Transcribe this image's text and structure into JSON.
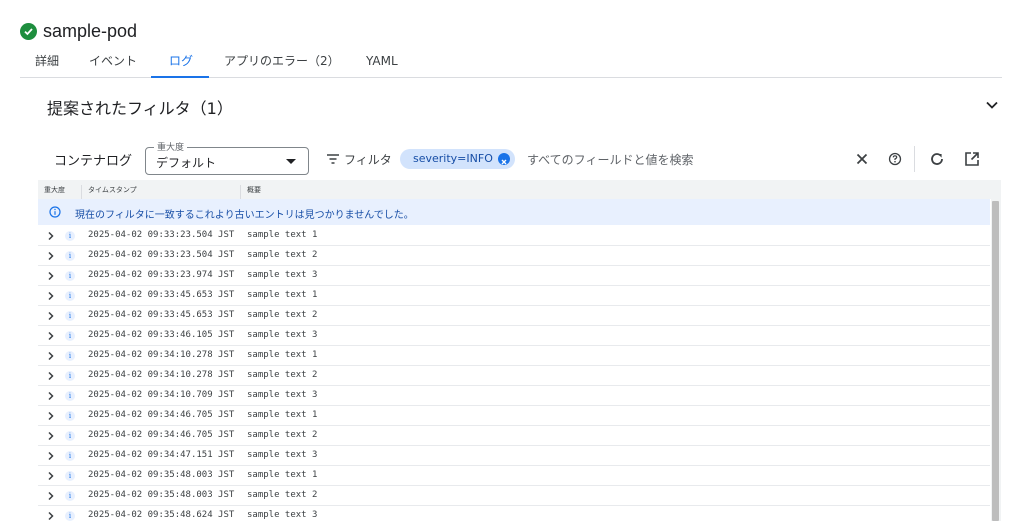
{
  "header": {
    "title": "sample-pod",
    "status_icon": "check-circle-icon",
    "status_color": "#1e8e3e"
  },
  "tabs": [
    {
      "label": "詳細"
    },
    {
      "label": "イベント"
    },
    {
      "label": "ログ",
      "active": true
    },
    {
      "label": "アプリのエラー（2）"
    },
    {
      "label": "YAML"
    }
  ],
  "suggested_filters": {
    "label": "提案されたフィルタ（1）"
  },
  "toolbar": {
    "container_log_label": "コンテナログ",
    "severity_legend": "重大度",
    "severity_value": "デフォルト",
    "filter_label": "フィルタ",
    "chip_label": "severity=INFO",
    "search_placeholder": "すべてのフィールドと値を検索"
  },
  "log_table": {
    "columns": [
      "重大度",
      "タイムスタンプ",
      "概要"
    ],
    "info_message": "現在のフィルタに一致するこれより古いエントリは見つかりませんでした。",
    "rows": [
      {
        "severity": "i",
        "timestamp": "2025-04-02 09:33:23.504 JST",
        "summary": "sample text 1"
      },
      {
        "severity": "i",
        "timestamp": "2025-04-02 09:33:23.504 JST",
        "summary": "sample text 2"
      },
      {
        "severity": "i",
        "timestamp": "2025-04-02 09:33:23.974 JST",
        "summary": "sample text 3"
      },
      {
        "severity": "i",
        "timestamp": "2025-04-02 09:33:45.653 JST",
        "summary": "sample text 1"
      },
      {
        "severity": "i",
        "timestamp": "2025-04-02 09:33:45.653 JST",
        "summary": "sample text 2"
      },
      {
        "severity": "i",
        "timestamp": "2025-04-02 09:33:46.105 JST",
        "summary": "sample text 3"
      },
      {
        "severity": "i",
        "timestamp": "2025-04-02 09:34:10.278 JST",
        "summary": "sample text 1"
      },
      {
        "severity": "i",
        "timestamp": "2025-04-02 09:34:10.278 JST",
        "summary": "sample text 2"
      },
      {
        "severity": "i",
        "timestamp": "2025-04-02 09:34:10.709 JST",
        "summary": "sample text 3"
      },
      {
        "severity": "i",
        "timestamp": "2025-04-02 09:34:46.705 JST",
        "summary": "sample text 1"
      },
      {
        "severity": "i",
        "timestamp": "2025-04-02 09:34:46.705 JST",
        "summary": "sample text 2"
      },
      {
        "severity": "i",
        "timestamp": "2025-04-02 09:34:47.151 JST",
        "summary": "sample text 3"
      },
      {
        "severity": "i",
        "timestamp": "2025-04-02 09:35:48.003 JST",
        "summary": "sample text 1"
      },
      {
        "severity": "i",
        "timestamp": "2025-04-02 09:35:48.003 JST",
        "summary": "sample text 2"
      },
      {
        "severity": "i",
        "timestamp": "2025-04-02 09:35:48.624 JST",
        "summary": "sample text 3"
      }
    ]
  }
}
